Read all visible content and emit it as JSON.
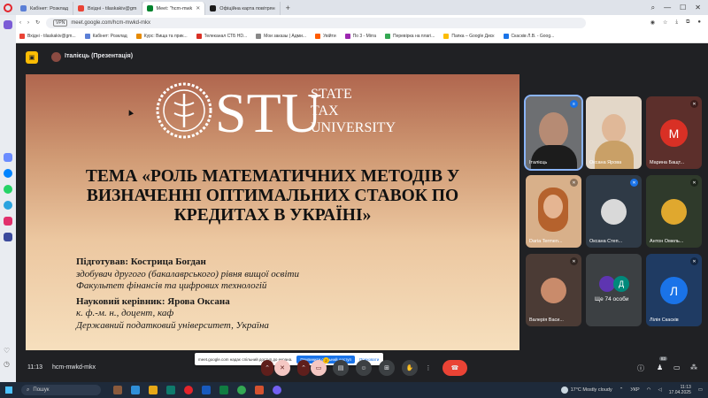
{
  "browser": {
    "tabs": [
      {
        "label": "Кабінет: Розклад",
        "color": "#5b7fd6",
        "active": false
      },
      {
        "label": "Вхідні - tilaskakiv@gm",
        "color": "#ea4335",
        "active": false
      },
      {
        "label": "Meet: \"hcm-mwk",
        "color": "#00832d",
        "active": true
      },
      {
        "label": "Офіційна карта повітрян",
        "color": "#1a1a1a",
        "active": false
      }
    ],
    "new_tab": "+",
    "url": "meet.google.com/hcm-mwkd-mkx",
    "vpn_label": "VPN",
    "bookmarks": [
      {
        "label": "Вхідні - tilaskakiv@gm...",
        "color": "#ea4335"
      },
      {
        "label": "Кабінет: Розклад",
        "color": "#5b7fd6"
      },
      {
        "label": "Курс: Вища та прик...",
        "color": "#e68a00"
      },
      {
        "label": "Телеканал СТБ HD...",
        "color": "#d93025"
      },
      {
        "label": "Мои заказы | Адми...",
        "color": "#888888"
      },
      {
        "label": "Увійти",
        "color": "#ff5c00"
      },
      {
        "label": "По 3 - Mirra",
        "color": "#9c27b0"
      },
      {
        "label": "Перевірка на плагі...",
        "color": "#34a853"
      },
      {
        "label": "Папка – Google Диск",
        "color": "#fbbc04"
      },
      {
        "label": "Скасків Л.В. - Goog...",
        "color": "#1a73e8"
      }
    ]
  },
  "meet": {
    "presenter_label": "Італієць (Презентація)",
    "time": "11:13",
    "meeting_code": "hcm-mwkd-mkx",
    "participant_count": "83",
    "reaction_badge": "2"
  },
  "slide": {
    "logo_big": "STU",
    "logo_lines": [
      "STATE",
      "TAX",
      "UNIVERSITY"
    ],
    "topic": "ТЕМА «РОЛЬ МАТЕМАТИЧНИХ МЕТОДІВ У ВИЗНАЧЕННІ ОПТИМАЛЬНИХ СТАВОК ПО КРЕДИТАХ В УКРАЇНІ»",
    "prepared_by": "Підготував: Кострица Богдан",
    "student_line": "здобувач другого (бакалаврського) рівня вищої освіти",
    "faculty_line": "Факультет фінансів та цифрових технологій",
    "supervisor": "Науковий керівник: Ярова Оксана",
    "degree_line": "к. ф.-м. н., доцент, каф",
    "university_line": "Державний податковий університет, Україна"
  },
  "share_popup": {
    "text": "meet.google.com надає спільний доступ до екрана.",
    "allow_label": "Припинити спільний доступ",
    "hide_label": "Приховати"
  },
  "participants": [
    {
      "name": "Італієць",
      "type": "photo",
      "active": true
    },
    {
      "name": "Оксана Ярова",
      "type": "photo"
    },
    {
      "name": "Марина Бащт...",
      "type": "letter",
      "letter": "М",
      "color": "#d93025"
    },
    {
      "name": "Daria Termen...",
      "type": "photo"
    },
    {
      "name": "Оксана Степ...",
      "type": "photo"
    },
    {
      "name": "Антон Омель...",
      "type": "emblem"
    },
    {
      "name": "Валерія Васи...",
      "type": "photo"
    },
    {
      "name": "Ще 74 особи",
      "type": "more",
      "letter": "Д"
    },
    {
      "name": "Лілія Скасків",
      "type": "letter",
      "letter": "Л",
      "color": "#1a73e8"
    }
  ],
  "taskbar": {
    "search_label": "Пошук",
    "weather": "17°C  Mostly cloudy",
    "lang": "УКР",
    "clock_time": "11:13",
    "clock_date": "17.04.2025"
  }
}
